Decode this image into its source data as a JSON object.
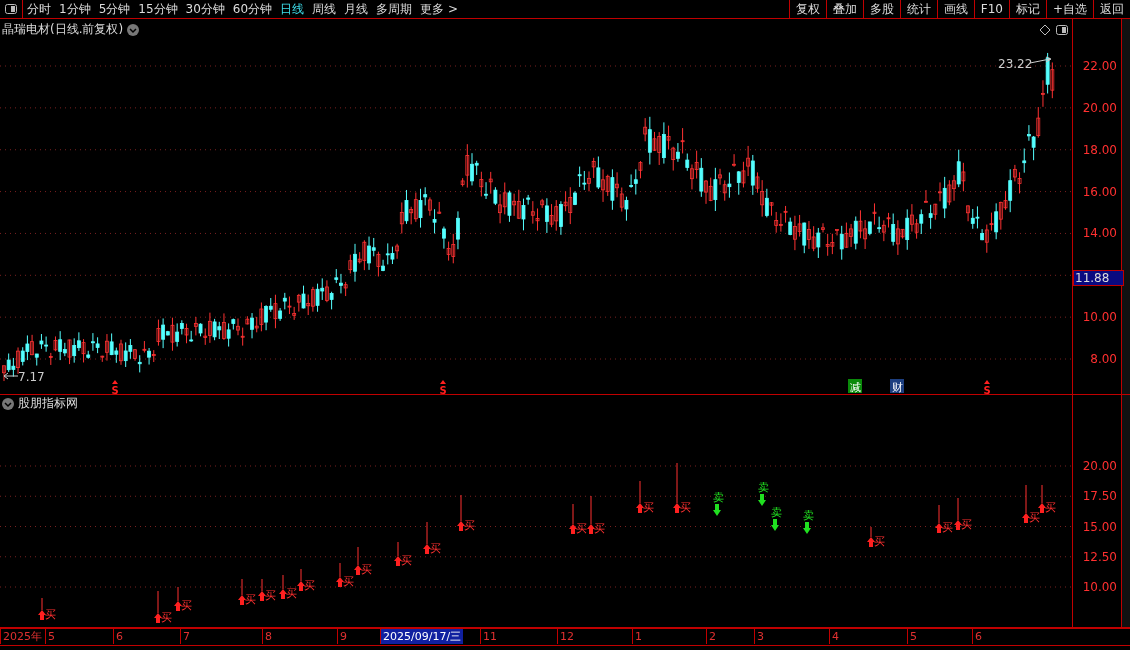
{
  "toolbar": {
    "periods": [
      {
        "label": "分时",
        "selected": false
      },
      {
        "label": "1分钟",
        "selected": false
      },
      {
        "label": "5分钟",
        "selected": false
      },
      {
        "label": "15分钟",
        "selected": false
      },
      {
        "label": "30分钟",
        "selected": false
      },
      {
        "label": "60分钟",
        "selected": false
      },
      {
        "label": "日线",
        "selected": true
      },
      {
        "label": "周线",
        "selected": false
      },
      {
        "label": "月线",
        "selected": false
      },
      {
        "label": "多周期",
        "selected": false
      },
      {
        "label": "更多 >",
        "selected": false
      }
    ],
    "buttons": [
      "复权",
      "叠加",
      "多股",
      "统计",
      "画线",
      "F10",
      "标记",
      "+自选",
      "返回"
    ]
  },
  "price_panel": {
    "title": "晶瑞电材(日线.前复权)",
    "yticks": [
      "22.00",
      "20.00",
      "18.00",
      "16.00",
      "14.00",
      "10.00",
      "8.00"
    ],
    "current_price": "11.88",
    "high_label": "23.22",
    "low_label": "7.17",
    "events": [
      {
        "kind": "caret",
        "label": "S"
      },
      {
        "kind": "caret",
        "label": "S"
      },
      {
        "kind": "badge",
        "label": "减",
        "color": "#0a8a0a"
      },
      {
        "kind": "badge",
        "label": "财",
        "color": "#1d3f80"
      },
      {
        "kind": "caret",
        "label": "S"
      }
    ]
  },
  "indicator_panel": {
    "title": "股朋指标网",
    "yticks": [
      "20.00",
      "17.50",
      "15.00",
      "12.50",
      "10.00"
    ],
    "signals": [
      {
        "kind": "buy",
        "label": "买"
      },
      {
        "kind": "buy",
        "label": "买"
      },
      {
        "kind": "buy",
        "label": "买"
      },
      {
        "kind": "buy",
        "label": "买"
      },
      {
        "kind": "buy",
        "label": "买"
      },
      {
        "kind": "buy",
        "label": "买"
      },
      {
        "kind": "buy",
        "label": "买"
      },
      {
        "kind": "buy",
        "label": "买"
      },
      {
        "kind": "buy",
        "label": "买"
      },
      {
        "kind": "buy",
        "label": "买"
      },
      {
        "kind": "buy",
        "label": "买"
      },
      {
        "kind": "buy",
        "label": "买"
      },
      {
        "kind": "buy",
        "label": "买"
      },
      {
        "kind": "buy",
        "label": "买"
      },
      {
        "kind": "buy",
        "label": "买"
      },
      {
        "kind": "buy",
        "label": "买"
      },
      {
        "kind": "sell",
        "label": "卖"
      },
      {
        "kind": "sell",
        "label": "卖"
      },
      {
        "kind": "sell",
        "label": "卖"
      },
      {
        "kind": "sell",
        "label": "卖"
      },
      {
        "kind": "buy",
        "label": "买"
      },
      {
        "kind": "buy",
        "label": "买"
      },
      {
        "kind": "buy",
        "label": "买"
      },
      {
        "kind": "buy",
        "label": "买"
      },
      {
        "kind": "buy",
        "label": "买"
      }
    ]
  },
  "date_axis": [
    {
      "label": "2025年",
      "selected": false
    },
    {
      "label": "5",
      "selected": false
    },
    {
      "label": "6",
      "selected": false
    },
    {
      "label": "7",
      "selected": false
    },
    {
      "label": "8",
      "selected": false
    },
    {
      "label": "9",
      "selected": false
    },
    {
      "label": "2025/09/17/三",
      "selected": true
    },
    {
      "label": "11",
      "selected": false
    },
    {
      "label": "12",
      "selected": false
    },
    {
      "label": "1",
      "selected": false
    },
    {
      "label": "2",
      "selected": false
    },
    {
      "label": "3",
      "selected": false
    },
    {
      "label": "4",
      "selected": false
    },
    {
      "label": "5",
      "selected": false
    },
    {
      "label": "6",
      "selected": false
    }
  ]
}
